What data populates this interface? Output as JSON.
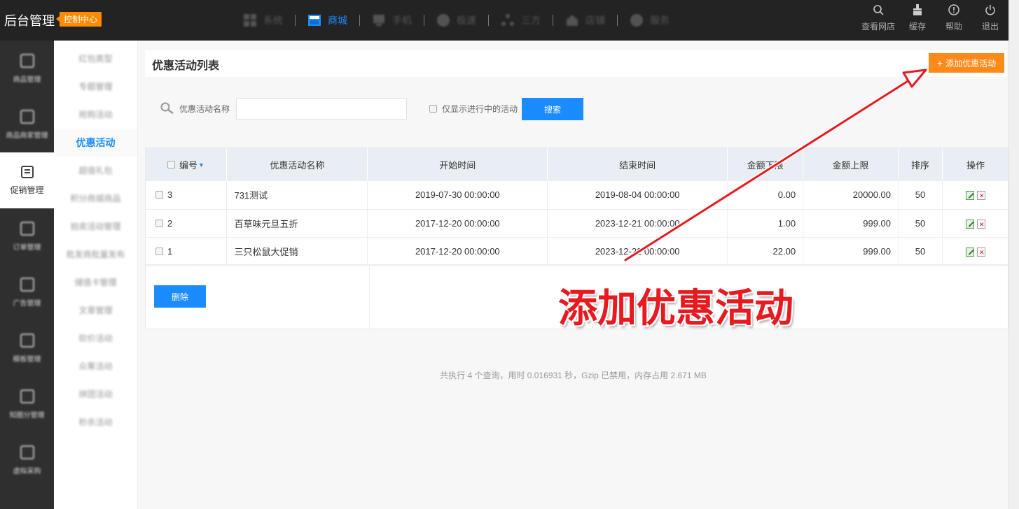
{
  "topbar": {
    "brand": "后台管理",
    "badge": "控制中心",
    "nav": [
      {
        "label": "系统",
        "icon": "grid-icon"
      },
      {
        "label": "商城",
        "icon": "shop-icon"
      },
      {
        "label": "手机",
        "icon": "mobile-icon"
      },
      {
        "label": "极速",
        "icon": "speed-icon"
      },
      {
        "label": "三方",
        "icon": "network-icon"
      },
      {
        "label": "店铺",
        "icon": "store-icon"
      },
      {
        "label": "服务",
        "icon": "cloud-icon"
      }
    ],
    "active_nav": "商城",
    "tools": [
      {
        "label": "查看网店",
        "icon": "search-icon"
      },
      {
        "label": "缓存",
        "icon": "broom-icon"
      },
      {
        "label": "帮助",
        "icon": "info-icon"
      },
      {
        "label": "退出",
        "icon": "power-icon"
      }
    ]
  },
  "sidebar": {
    "items": [
      {
        "label": "商品管理"
      },
      {
        "label": "商品商家管理"
      },
      {
        "label": "促销管理"
      },
      {
        "label": "订单管理"
      },
      {
        "label": "广告管理"
      },
      {
        "label": "模板管理"
      },
      {
        "label": "知圈分管理"
      },
      {
        "label": "虚拟采购"
      }
    ],
    "active": "促销管理"
  },
  "submenu": {
    "items": [
      {
        "label": "红包类型"
      },
      {
        "label": "专题管理"
      },
      {
        "label": "抢购活动"
      },
      {
        "label": "优惠活动"
      },
      {
        "label": "超值礼包"
      },
      {
        "label": "积分商城商品"
      },
      {
        "label": "拍卖活动管理"
      },
      {
        "label": "批发商批量发布"
      },
      {
        "label": "储值卡管理"
      },
      {
        "label": "文章管理"
      },
      {
        "label": "砍价活动"
      },
      {
        "label": "众筹活动"
      },
      {
        "label": "拼团活动"
      },
      {
        "label": "秒杀活动"
      }
    ],
    "active": "优惠活动"
  },
  "page": {
    "title": "优惠活动列表",
    "add_button": "添加优惠活动",
    "search_label": "优惠活动名称",
    "search_value": "",
    "only_active_label": "仅显示进行中的活动",
    "search_button": "搜索",
    "delete_button": "删除",
    "stats": "共执行 4 个查询，用时 0.016931 秒，Gzip 已禁用，内存占用 2.671 MB"
  },
  "table": {
    "headers": {
      "id": "编号",
      "name": "优惠活动名称",
      "start": "开始时间",
      "end": "结束时间",
      "min": "金额下限",
      "max": "金额上限",
      "sort": "排序",
      "op": "操作"
    },
    "rows": [
      {
        "id": "3",
        "name": "731测试",
        "start": "2019-07-30 00:00:00",
        "end": "2019-08-04 00:00:00",
        "min": "0.00",
        "max": "20000.00",
        "sort": "50"
      },
      {
        "id": "2",
        "name": "百草味元旦五折",
        "start": "2017-12-20 00:00:00",
        "end": "2023-12-21 00:00:00",
        "min": "1.00",
        "max": "999.00",
        "sort": "50"
      },
      {
        "id": "1",
        "name": "三只松鼠大促销",
        "start": "2017-12-20 00:00:00",
        "end": "2023-12-22 00:00:00",
        "min": "22.00",
        "max": "999.00",
        "sort": "50"
      }
    ]
  },
  "annotation": {
    "text": "添加优惠活动",
    "color": "#e8191f"
  },
  "colors": {
    "accent_blue": "#1a8cff",
    "accent_orange": "#ff8a1a",
    "topbar_bg": "#232323",
    "sidebar_bg": "#2f2f2f"
  }
}
